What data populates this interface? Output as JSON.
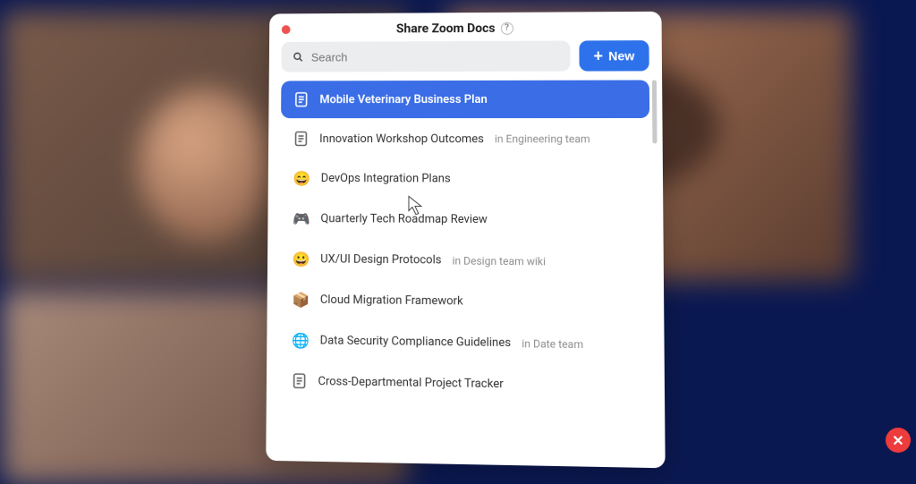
{
  "panel": {
    "title": "Share Zoom Docs",
    "help_tooltip": "?",
    "search_placeholder": "Search",
    "new_button_label": "New"
  },
  "docs": [
    {
      "title": "Mobile Veterinary Business Plan",
      "meta": "",
      "icon": "document",
      "selected": true
    },
    {
      "title": "Innovation Workshop Outcomes",
      "meta": "in Engineering team",
      "icon": "document",
      "selected": false
    },
    {
      "title": "DevOps Integration Plans",
      "meta": "",
      "icon": "emoji-smile-blue",
      "selected": false
    },
    {
      "title": "Quarterly Tech Roadmap Review",
      "meta": "",
      "icon": "emoji-gamepad",
      "selected": false
    },
    {
      "title": "UX/UI Design Protocols",
      "meta": "in Design team wiki",
      "icon": "emoji-smile-yellow",
      "selected": false
    },
    {
      "title": "Cloud Migration Framework",
      "meta": "",
      "icon": "emoji-package",
      "selected": false
    },
    {
      "title": "Data Security Compliance Guidelines",
      "meta": "in Date team",
      "icon": "emoji-orbit",
      "selected": false
    },
    {
      "title": "Cross-Departmental Project Tracker",
      "meta": "",
      "icon": "document",
      "selected": false
    }
  ],
  "colors": {
    "accent": "#2d72ea",
    "close": "#ee3b3b"
  }
}
